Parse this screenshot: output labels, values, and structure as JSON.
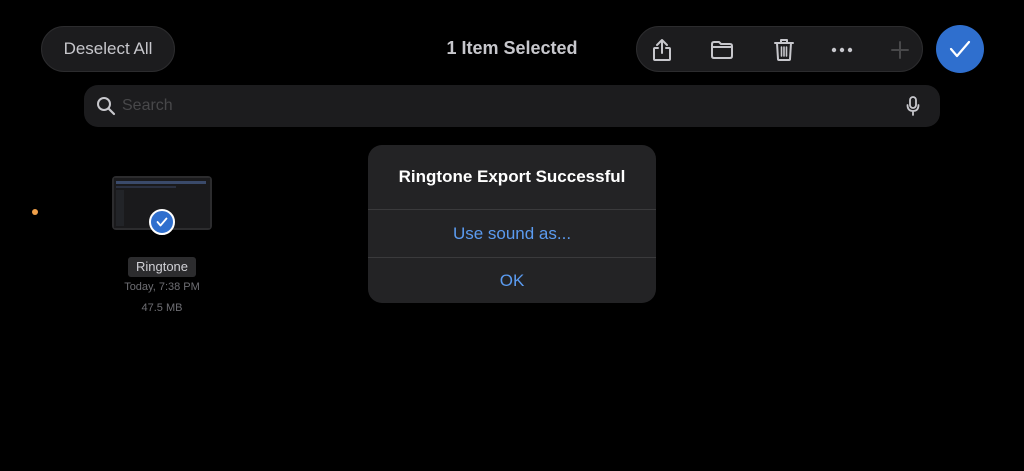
{
  "header": {
    "deselect_label": "Deselect All",
    "title": "1 Item Selected",
    "toolbar": {
      "share_icon": "share-icon",
      "folder_icon": "folder-icon",
      "trash_icon": "trash-icon",
      "more_icon": "more-icon",
      "add_icon": "plus-icon"
    },
    "done_icon": "checkmark-icon"
  },
  "search": {
    "placeholder": "Search",
    "value": ""
  },
  "file": {
    "name": "Ringtone",
    "date": "Today, 7:38 PM",
    "size": "47.5 MB",
    "selected": true
  },
  "alert": {
    "title": "Ringtone Export Successful",
    "primary_action": "Use sound as...",
    "ok_action": "OK"
  },
  "colors": {
    "accent": "#2f6fce",
    "link": "#5b9bf0",
    "status_dot": "#f0a04a"
  }
}
